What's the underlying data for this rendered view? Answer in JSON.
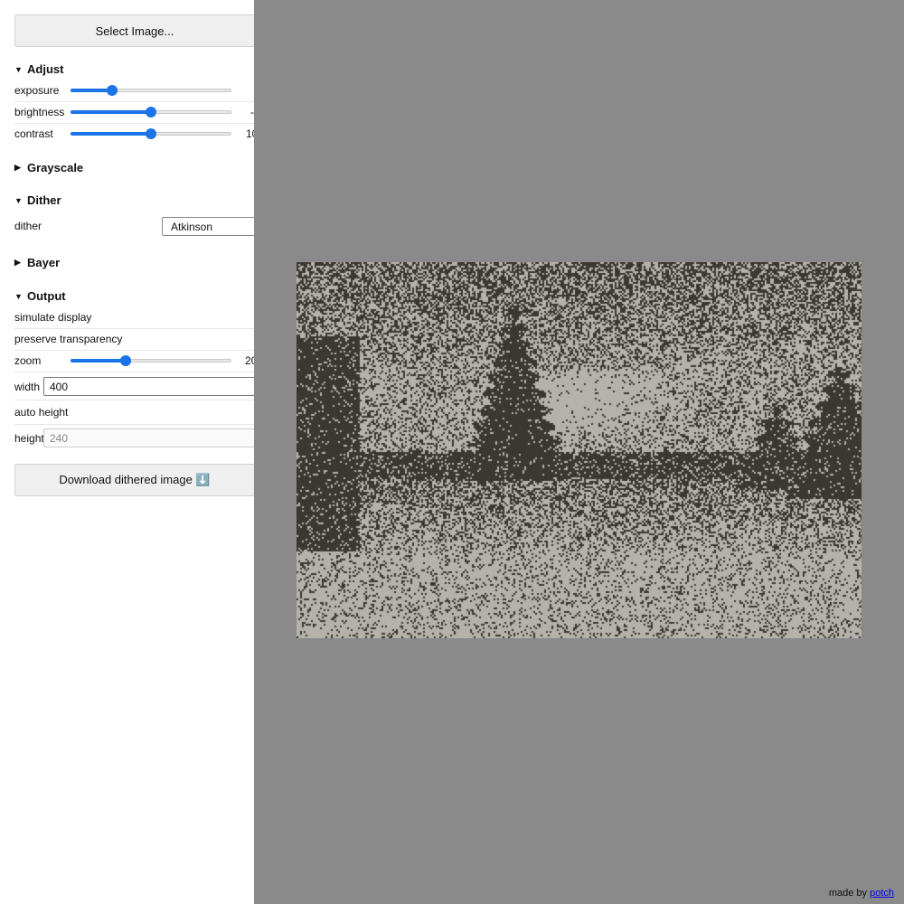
{
  "sidebar": {
    "select_image_label": "Select Image...",
    "adjust": {
      "title": "Adjust",
      "exposure": {
        "label": "exposure",
        "value_fraction": 0.26
      },
      "brightness": {
        "label": "brightness",
        "value_fraction": 0.5,
        "value_text": "-"
      },
      "contrast": {
        "label": "contrast",
        "value_fraction": 0.5,
        "value_text": "10"
      }
    },
    "grayscale": {
      "title": "Grayscale"
    },
    "dither": {
      "title": "Dither",
      "label": "dither",
      "selected": "Atkinson"
    },
    "bayer": {
      "title": "Bayer"
    },
    "output": {
      "title": "Output",
      "simulate_display_label": "simulate display",
      "preserve_transparency_label": "preserve transparency",
      "zoom": {
        "label": "zoom",
        "value_fraction": 0.34,
        "value_text": "20"
      },
      "width": {
        "label": "width",
        "value": "400"
      },
      "auto_height_label": "auto height",
      "height": {
        "label": "height",
        "placeholder": "240"
      }
    },
    "download_label": "Download dithered image ⬇️"
  },
  "footer": {
    "made_by": "made by",
    "author_link": "potch"
  },
  "colors": {
    "accent": "#1a73e8",
    "canvas_bg": "#8a8a8a",
    "dither_dark": "#3a3830",
    "dither_light": "#b4b2aa"
  }
}
